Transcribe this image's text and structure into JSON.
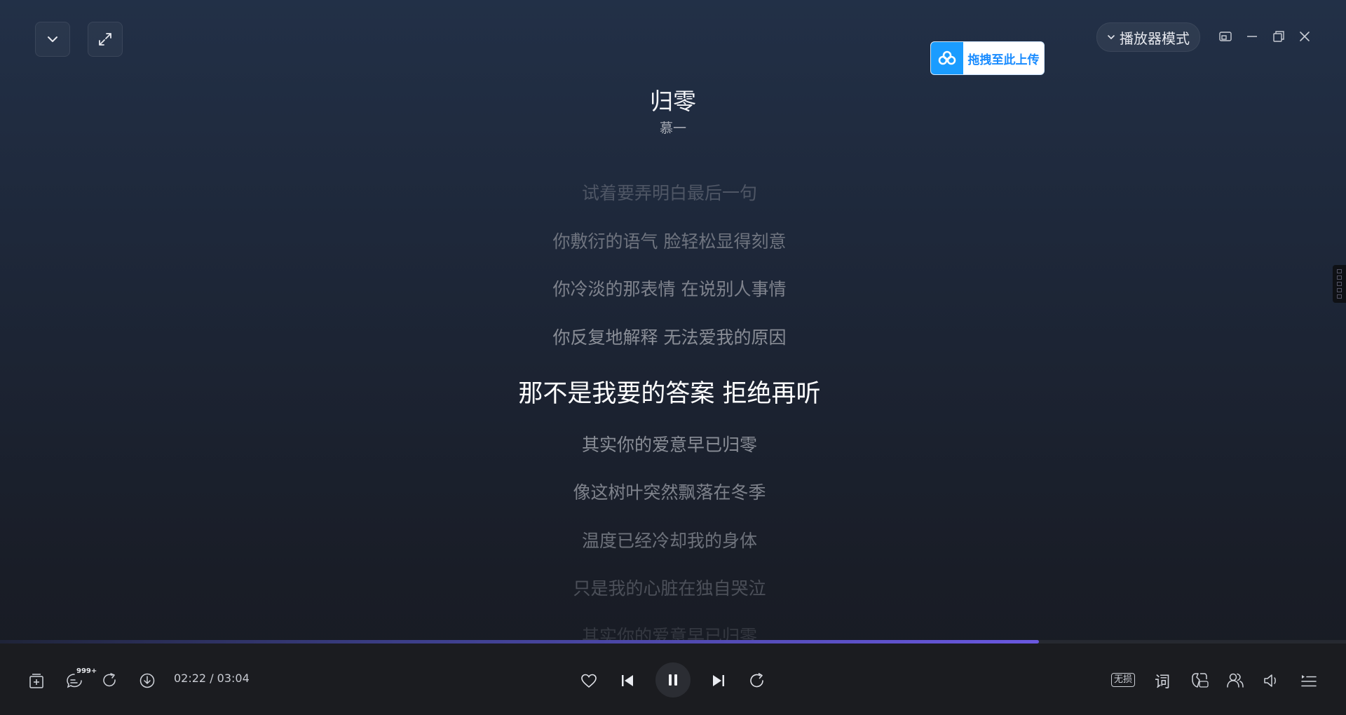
{
  "header": {
    "mode_label": "播放器模式",
    "upload_label": "拖拽至此上传"
  },
  "song": {
    "title": "归零",
    "artist": "慕一"
  },
  "lyrics": [
    "试着要弄明白最后一句",
    "你敷衍的语气 脸轻松显得刻意",
    "你冷淡的那表情 在说别人事情",
    "你反复地解释 无法爱我的原因",
    "那不是我要的答案 拒绝再听",
    "其实你的爱意早已归零",
    "像这树叶突然飘落在冬季",
    "温度已经冷却我的身体",
    "只是我的心脏在独自哭泣",
    "其实你的爱意早已归零"
  ],
  "player": {
    "time": "02:22 / 03:04",
    "progress": 0.772,
    "comment_count": "999+",
    "quality_label": "无损",
    "lyric_button_label": "词"
  }
}
